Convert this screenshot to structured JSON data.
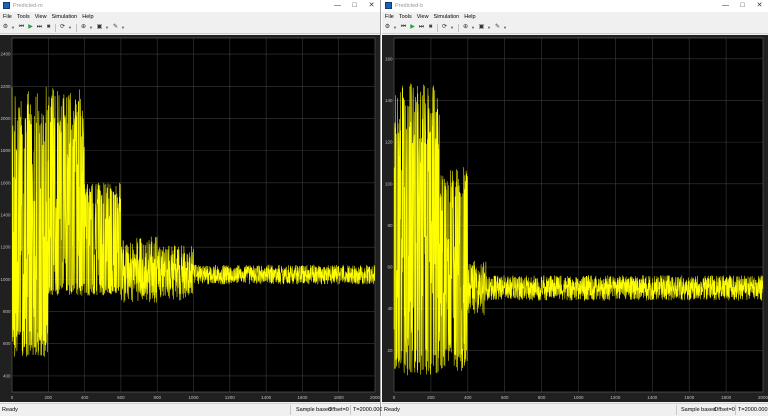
{
  "windows": [
    {
      "id": "left",
      "title": "Predicted-m",
      "menu": [
        "File",
        "Tools",
        "View",
        "Simulation",
        "Help"
      ],
      "status": {
        "state": "Ready",
        "mode": "Sample based",
        "offset": "Offset=0",
        "time": "T=2000.000"
      },
      "chart_data": {
        "type": "line",
        "xlim": [
          0,
          2000
        ],
        "ylim": [
          300,
          2500
        ],
        "xticks": [
          "0",
          "200",
          "400",
          "600",
          "800",
          "1000",
          "1200",
          "1400",
          "1600",
          "1800",
          "2000"
        ],
        "yticks": [
          "400",
          "600",
          "800",
          "1000",
          "1200",
          "1400",
          "1600",
          "1800",
          "2000",
          "2200",
          "2400"
        ],
        "line_color": "#ffff00",
        "grid": true,
        "segments": [
          {
            "x": [
              0,
              200
            ],
            "low": 520,
            "high": 2200,
            "steady": 1100
          },
          {
            "x": [
              200,
              400
            ],
            "low": 900,
            "high": 2200,
            "steady": 1150
          },
          {
            "x": [
              400,
              600
            ],
            "low": 900,
            "high": 1600,
            "steady": 1150
          },
          {
            "x": [
              600,
              800
            ],
            "low": 940,
            "high": 1350,
            "steady": 1060
          },
          {
            "x": [
              800,
              1000
            ],
            "low": 960,
            "high": 1300,
            "steady": 1040
          },
          {
            "x": [
              1000,
              2000
            ],
            "low": 970,
            "high": 1090,
            "steady": 1030
          }
        ]
      }
    },
    {
      "id": "right",
      "title": "Predicted-b",
      "menu": [
        "File",
        "Tools",
        "View",
        "Simulation",
        "Help"
      ],
      "status": {
        "state": "Ready",
        "mode": "Sample based",
        "offset": "Offset=0",
        "time": "T=2000.000"
      },
      "chart_data": {
        "type": "line",
        "xlim": [
          0,
          2000
        ],
        "ylim": [
          0,
          170
        ],
        "xticks": [
          "0",
          "200",
          "400",
          "600",
          "800",
          "1000",
          "1200",
          "1400",
          "1600",
          "1800",
          "2000"
        ],
        "yticks": [
          "20",
          "40",
          "60",
          "80",
          "100",
          "120",
          "140",
          "160"
        ],
        "line_color": "#ffff00",
        "grid": true,
        "segments": [
          {
            "x": [
              0,
              250
            ],
            "low": 8,
            "high": 148,
            "steady": 50
          },
          {
            "x": [
              250,
              400
            ],
            "low": 10,
            "high": 108,
            "steady": 50
          },
          {
            "x": [
              400,
              500
            ],
            "low": 38,
            "high": 64,
            "steady": 50
          },
          {
            "x": [
              500,
              2000
            ],
            "low": 44,
            "high": 56,
            "steady": 50
          }
        ]
      }
    }
  ]
}
